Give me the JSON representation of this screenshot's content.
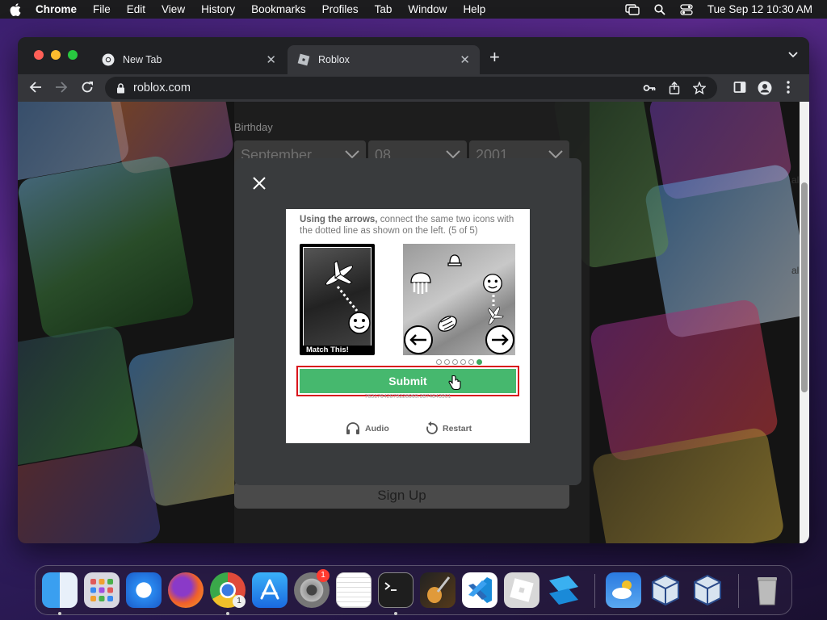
{
  "menubar": {
    "app": "Chrome",
    "items": [
      "File",
      "Edit",
      "View",
      "History",
      "Bookmarks",
      "Profiles",
      "Tab",
      "Window",
      "Help"
    ],
    "datetime": "Tue Sep 12  10:30 AM"
  },
  "tabs": [
    {
      "label": "New Tab",
      "icon": "chrome-icon"
    },
    {
      "label": "Roblox",
      "icon": "roblox-icon"
    }
  ],
  "address": {
    "url": "roblox.com"
  },
  "signup": {
    "birthday_label": "Birthday",
    "month": "September",
    "day": "08",
    "year": "2001",
    "signup_button": "Sign Up"
  },
  "captcha": {
    "instruction_bold": "Using the arrows,",
    "instruction_rest": " connect the same two icons with the dotted line as shown on the left. (5 of 5)",
    "match_label": "Match This!",
    "submit_label": "Submit",
    "session_id": "76317642079228069.3974843901",
    "audio_label": "Audio",
    "restart_label": "Restart",
    "progress": {
      "current": 5,
      "total": 6
    }
  },
  "side_text": [
    "al",
    "al"
  ],
  "dock": {
    "settings_badge": "1",
    "chrome_badge": "1"
  },
  "colors": {
    "accent_green": "#46b86e",
    "highlight_red": "#d9141c"
  }
}
